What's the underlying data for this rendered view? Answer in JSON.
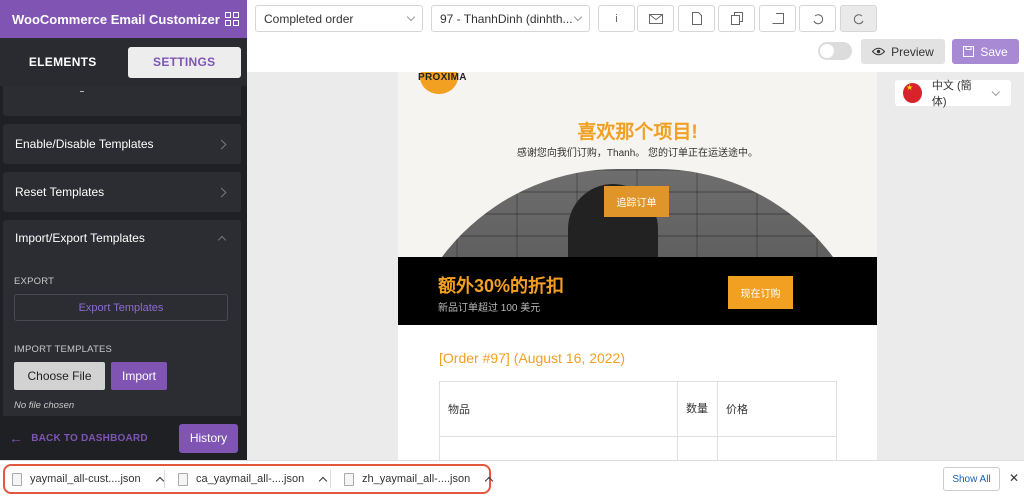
{
  "sidebar": {
    "title": "WooCommerce Email Customizer",
    "tabs": [
      {
        "label": "ELEMENTS"
      },
      {
        "label": "SETTINGS"
      }
    ],
    "items": [
      {
        "label": "Enable/Disable Templates"
      },
      {
        "label": "Reset Templates"
      },
      {
        "label": "Import/Export Templates"
      }
    ],
    "export_label": "EXPORT",
    "export_button": "Export Templates",
    "import_label": "IMPORT TEMPLATES",
    "choose_file": "Choose File",
    "import_button": "Import",
    "no_file": "No file chosen",
    "back": "BACK TO DASHBOARD",
    "history": "History"
  },
  "toolbar": {
    "template_select": "Completed order",
    "order_select": "97 - ThanhDinh (dinhth...",
    "info_label": "i",
    "preview": "Preview",
    "save": "Save"
  },
  "language": {
    "label": "中文 (簡体)"
  },
  "email": {
    "logo": "PROXIMA",
    "hero_title": "喜欢那个项目!",
    "hero_sub": "感谢您向我们订购，Thanh。 您的订单正在运送途中。",
    "track_button": "追踪订单",
    "banner_title": "额外30%的折扣",
    "banner_sub": "新品订单超过 100 美元",
    "banner_button": "现在订购",
    "order_title": "[Order #97] (August 16, 2022)",
    "table_headers": [
      "物品",
      "数量",
      "价格"
    ]
  },
  "downloads": {
    "items": [
      {
        "name": "yaymail_all-cust....json"
      },
      {
        "name": "ca_yaymail_all-....json"
      },
      {
        "name": "zh_yaymail_all-....json"
      }
    ],
    "show_all": "Show All",
    "close": "✕"
  }
}
